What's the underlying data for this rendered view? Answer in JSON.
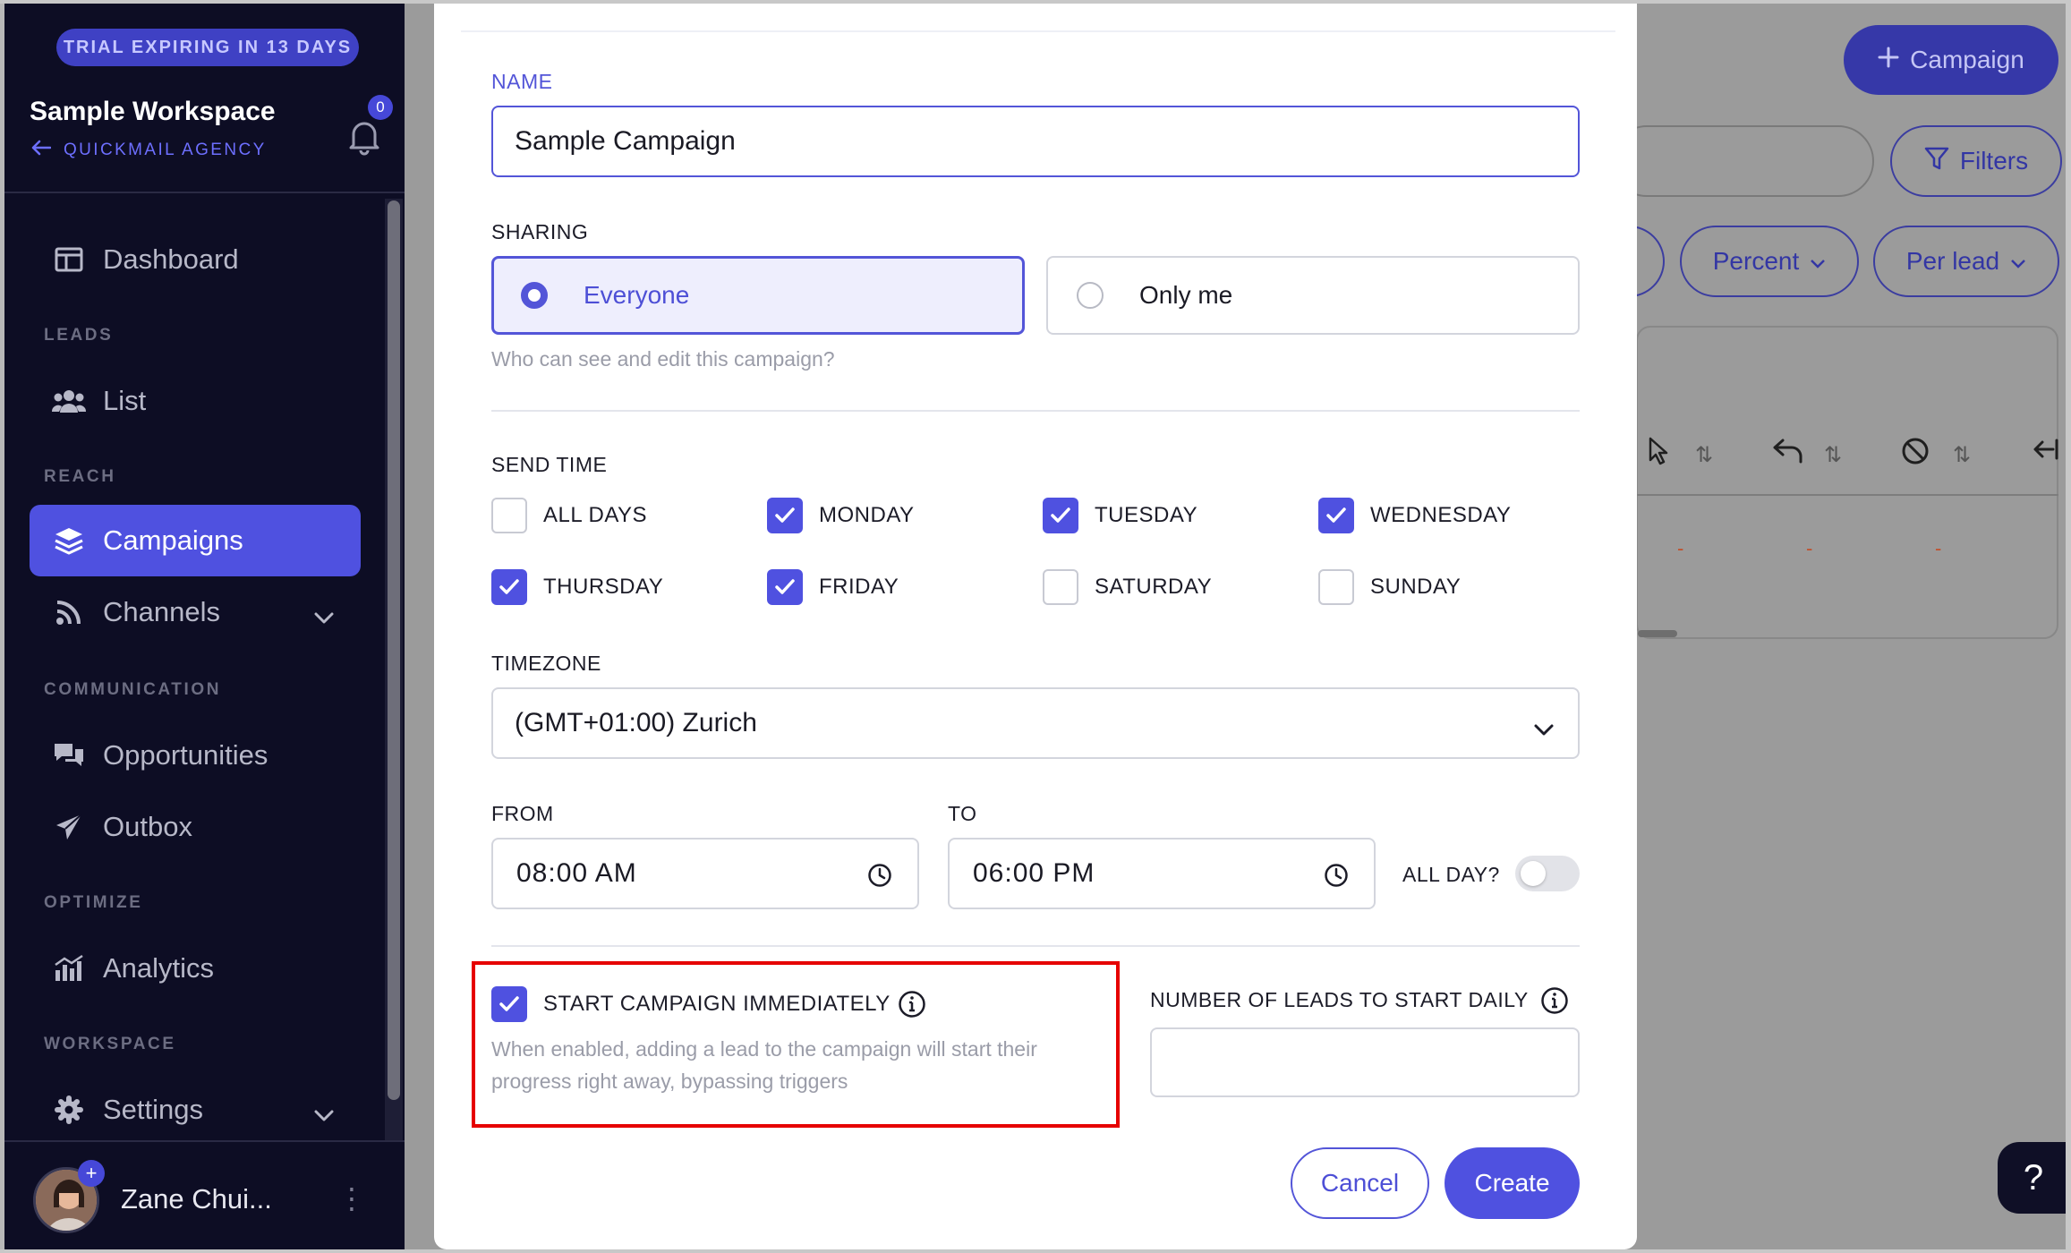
{
  "sidebar": {
    "trial_badge": "TRIAL EXPIRING IN 13 DAYS",
    "workspace_name": "Sample Workspace",
    "workspace_sub": "QUICKMAIL AGENCY",
    "notifications": "0",
    "sections": {
      "leads": "LEADS",
      "reach": "REACH",
      "communication": "COMMUNICATION",
      "optimize": "OPTIMIZE",
      "workspace": "WORKSPACE"
    },
    "items": {
      "dashboard": "Dashboard",
      "list": "List",
      "campaigns": "Campaigns",
      "channels": "Channels",
      "opportunities": "Opportunities",
      "outbox": "Outbox",
      "analytics": "Analytics",
      "settings": "Settings"
    },
    "active_item": "Campaigns",
    "user_name": "Zane Chui..."
  },
  "background": {
    "new_campaign_button": "Campaign",
    "filters_button": "Filters",
    "percent_dropdown": "Percent",
    "per_lead_dropdown": "Per lead",
    "placeholder_cells": [
      "-",
      "-",
      "-"
    ],
    "help_button": "?"
  },
  "modal": {
    "name_label": "NAME",
    "name_value": "Sample Campaign",
    "sharing_label": "SHARING",
    "sharing_options": {
      "everyone": "Everyone",
      "only_me": "Only me"
    },
    "sharing_selected": "Everyone",
    "sharing_helper": "Who can see and edit this campaign?",
    "send_time_label": "SEND TIME",
    "days": {
      "all_days": {
        "label": "ALL DAYS",
        "checked": false
      },
      "monday": {
        "label": "MONDAY",
        "checked": true
      },
      "tuesday": {
        "label": "TUESDAY",
        "checked": true
      },
      "wednesday": {
        "label": "WEDNESDAY",
        "checked": true
      },
      "thursday": {
        "label": "THURSDAY",
        "checked": true
      },
      "friday": {
        "label": "FRIDAY",
        "checked": true
      },
      "saturday": {
        "label": "SATURDAY",
        "checked": false
      },
      "sunday": {
        "label": "SUNDAY",
        "checked": false
      }
    },
    "timezone_label": "TIMEZONE",
    "timezone_value": "(GMT+01:00) Zurich",
    "from_label": "FROM",
    "from_value": "08:00 AM",
    "to_label": "TO",
    "to_value": "06:00 PM",
    "all_day_label": "ALL DAY?",
    "all_day_on": false,
    "start_immediately_label": "START CAMPAIGN IMMEDIATELY",
    "start_immediately_checked": true,
    "start_immediately_helper_line1": "When enabled, adding a lead to the campaign will start their",
    "start_immediately_helper_line2": "progress right away, bypassing triggers",
    "leads_daily_label": "NUMBER OF LEADS TO START DAILY",
    "leads_daily_value": "",
    "cancel_button": "Cancel",
    "create_button": "Create"
  },
  "colors": {
    "accent": "#4f51e0",
    "sidebar_bg": "#0d0d24",
    "highlight": "#e60000"
  }
}
